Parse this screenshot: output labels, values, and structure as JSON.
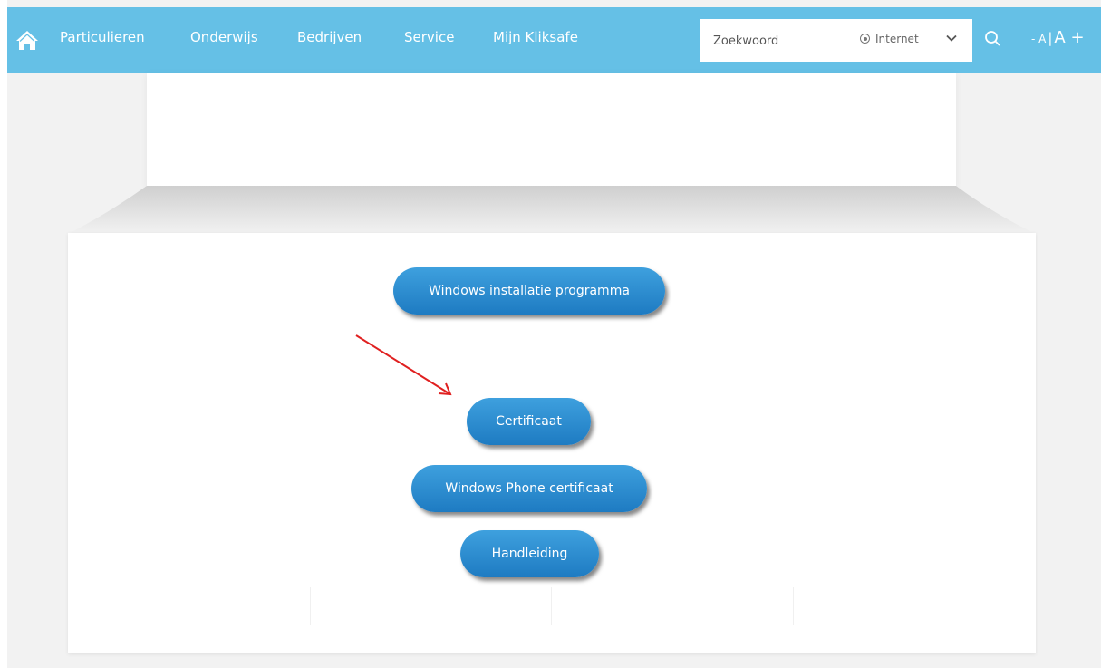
{
  "nav": {
    "home_icon": "home-icon",
    "items": [
      {
        "label": "Particulieren"
      },
      {
        "label": "Onderwijs"
      },
      {
        "label": "Bedrijven"
      },
      {
        "label": "Service"
      },
      {
        "label": "Mijn Kliksafe"
      }
    ]
  },
  "search": {
    "placeholder": "Zoekwoord",
    "value": "",
    "scope_label": "Internet",
    "scope_icon": "chevron-down-icon",
    "submit_icon": "search-icon"
  },
  "font_size": {
    "decrease": "- A",
    "separator": "|",
    "increase": "A +"
  },
  "buttons": {
    "windows_installer": "Windows installatie programma",
    "certificate": "Certificaat",
    "windows_phone_certificate": "Windows Phone certificaat",
    "manual": "Handleiding"
  },
  "colors": {
    "topbar": "#65c0e6",
    "button": "#2a8fd3",
    "annotation_arrow": "#e02020"
  }
}
